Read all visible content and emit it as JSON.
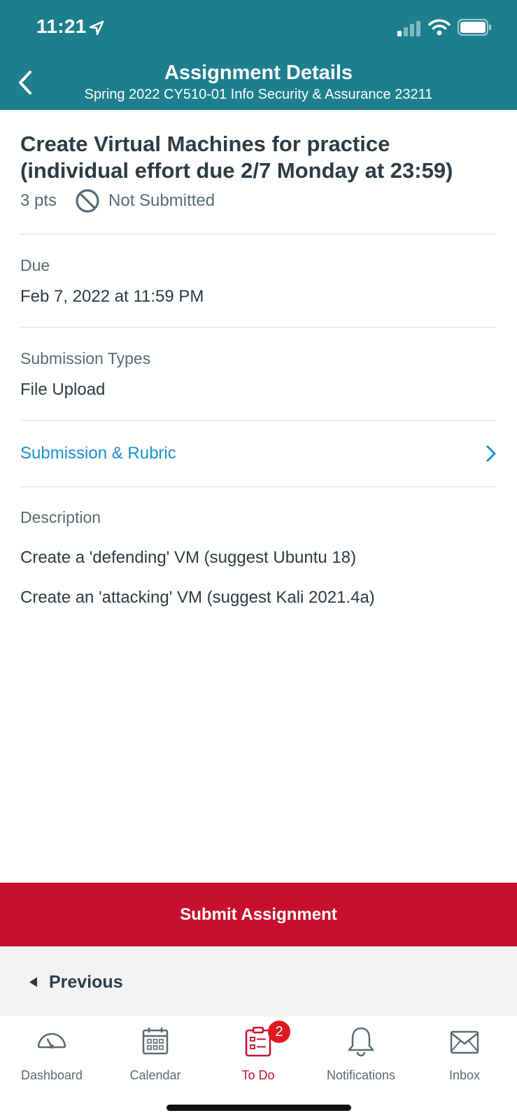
{
  "status_bar": {
    "time": "11:21"
  },
  "header": {
    "title": "Assignment Details",
    "subtitle": "Spring 2022 CY510-01 Info Security & Assurance 23211"
  },
  "assignment": {
    "title_line1": "Create Virtual Machines for practice",
    "title_line2": "(individual effort due 2/7 Monday at 23:59)",
    "points": "3 pts",
    "status": "Not Submitted"
  },
  "due": {
    "label": "Due",
    "value": "Feb 7, 2022 at 11:59 PM"
  },
  "submission_types": {
    "label": "Submission Types",
    "value": "File Upload"
  },
  "rubric_link": {
    "label": "Submission & Rubric"
  },
  "description": {
    "label": "Description",
    "lines": [
      "Create a 'defending' VM (suggest Ubuntu 18)",
      "Create an 'attacking' VM (suggest Kali 2021.4a)"
    ]
  },
  "submit_button": {
    "label": "Submit Assignment"
  },
  "previous_button": {
    "label": "Previous"
  },
  "tabs": [
    {
      "label": "Dashboard",
      "icon": "dashboard-icon"
    },
    {
      "label": "Calendar",
      "icon": "calendar-icon"
    },
    {
      "label": "To Do",
      "icon": "todo-icon",
      "badge": "2",
      "active": true
    },
    {
      "label": "Notifications",
      "icon": "bell-icon"
    },
    {
      "label": "Inbox",
      "icon": "envelope-icon"
    }
  ],
  "colors": {
    "header_bg": "#1d7f8e",
    "submit_bg": "#c8102e",
    "link": "#1b8fd1",
    "active_tab": "#c8102e"
  }
}
